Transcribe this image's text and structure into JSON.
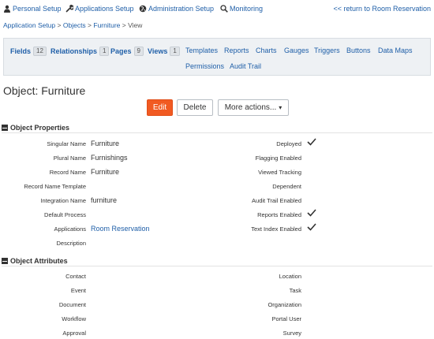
{
  "topnav": {
    "personal_setup": "Personal Setup",
    "applications_setup": "Applications Setup",
    "administration_setup": "Administration Setup",
    "monitoring": "Monitoring",
    "return_link": "<< return to Room Reservation"
  },
  "breadcrumb": {
    "app_setup": "Application Setup",
    "sep1": " > ",
    "objects": "Objects",
    "sep2": " > ",
    "furniture": "Furniture",
    "sep3": " > ",
    "current": "View"
  },
  "tabs": {
    "fields": "Fields",
    "fields_count": "12",
    "relationships": "Relationships",
    "relationships_count": "1",
    "pages": "Pages",
    "pages_count": "9",
    "views": "Views",
    "views_count": "1",
    "templates": "Templates",
    "reports": "Reports",
    "charts": "Charts",
    "gauges": "Gauges",
    "triggers": "Triggers",
    "buttons": "Buttons",
    "data_maps": "Data Maps",
    "permissions": "Permissions",
    "audit_trail": "Audit Trail"
  },
  "object_title": "Object: Furniture",
  "actions": {
    "edit": "Edit",
    "delete": "Delete",
    "more": "More actions...",
    "more_caret": "▾"
  },
  "properties": {
    "header": "Object Properties",
    "left": [
      {
        "label": "Singular Name",
        "value": "Furniture"
      },
      {
        "label": "Plural Name",
        "value": "Furnishings"
      },
      {
        "label": "Record Name",
        "value": "Furniture"
      },
      {
        "label": "Record Name Template",
        "value": ""
      },
      {
        "label": "Integration Name",
        "value": "furniture"
      },
      {
        "label": "Default Process",
        "value": ""
      },
      {
        "label": "Applications",
        "value": "Room Reservation"
      },
      {
        "label": "Description",
        "value": ""
      }
    ],
    "right": [
      {
        "label": "Deployed",
        "checked": true
      },
      {
        "label": "Flagging Enabled",
        "checked": false
      },
      {
        "label": "Viewed Tracking",
        "checked": false
      },
      {
        "label": "Dependent",
        "checked": false
      },
      {
        "label": "Audit Trail Enabled",
        "checked": false
      },
      {
        "label": "Reports Enabled",
        "checked": true
      },
      {
        "label": "Text Index Enabled",
        "checked": true
      }
    ]
  },
  "attributes": {
    "header": "Object Attributes",
    "left": [
      "Contact",
      "Event",
      "Document",
      "Workflow",
      "Approval"
    ],
    "right": [
      "Location",
      "Task",
      "Organization",
      "Portal User",
      "Survey"
    ]
  },
  "colors": {
    "link": "#1f5fa8",
    "primary_button": "#f15a22",
    "tab_bar_bg": "#eef1f4"
  }
}
